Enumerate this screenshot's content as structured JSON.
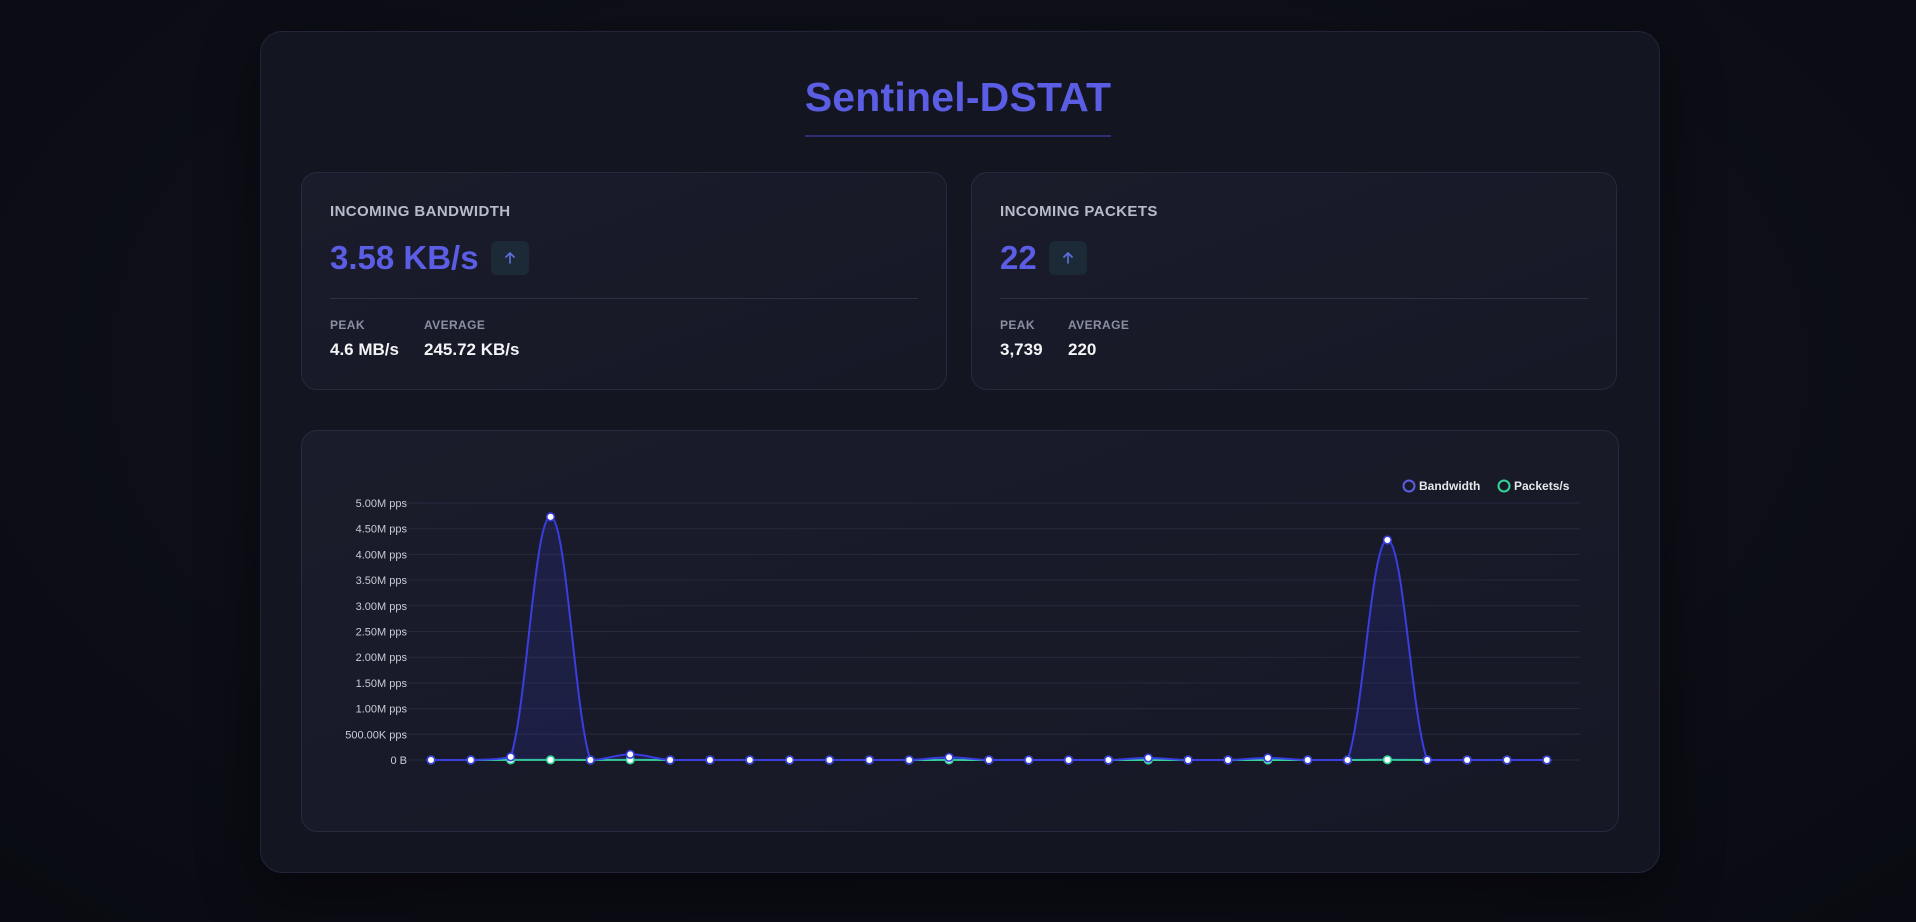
{
  "app": {
    "title": "Sentinel-DSTAT"
  },
  "colors": {
    "accent": "#5b5de4",
    "bandwidth_line": "#3a3de0",
    "packets_line": "#34d399"
  },
  "cards": [
    {
      "label": "INCOMING BANDWIDTH",
      "value": "3.58 KB/s",
      "trend_icon": "arrow-up-icon",
      "stats": [
        {
          "label": "PEAK",
          "value": "4.6 MB/s"
        },
        {
          "label": "AVERAGE",
          "value": "245.72 KB/s"
        }
      ]
    },
    {
      "label": "INCOMING PACKETS",
      "value": "22",
      "trend_icon": "arrow-up-icon",
      "stats": [
        {
          "label": "PEAK",
          "value": "3,739"
        },
        {
          "label": "AVERAGE",
          "value": "220"
        }
      ]
    }
  ],
  "chart_data": {
    "type": "line",
    "ylim": [
      0,
      5000000
    ],
    "yticks": [
      {
        "value": 0,
        "label": "0 B"
      },
      {
        "value": 500000,
        "label": "500.00K pps"
      },
      {
        "value": 1000000,
        "label": "1.00M pps"
      },
      {
        "value": 1500000,
        "label": "1.50M pps"
      },
      {
        "value": 2000000,
        "label": "2.00M pps"
      },
      {
        "value": 2500000,
        "label": "2.50M pps"
      },
      {
        "value": 3000000,
        "label": "3.00M pps"
      },
      {
        "value": 3500000,
        "label": "3.50M pps"
      },
      {
        "value": 4000000,
        "label": "4.00M pps"
      },
      {
        "value": 4500000,
        "label": "4.50M pps"
      },
      {
        "value": 5000000,
        "label": "5.00M pps"
      }
    ],
    "grid": true,
    "legend_position": "top-right",
    "series": [
      {
        "name": "Bandwidth",
        "color": "#3a3de0",
        "values": [
          0,
          0,
          60000,
          4730000,
          0,
          110000,
          0,
          0,
          0,
          0,
          0,
          0,
          0,
          50000,
          0,
          0,
          0,
          0,
          40000,
          0,
          0,
          40000,
          0,
          0,
          4280000,
          0,
          0,
          0,
          0
        ]
      },
      {
        "name": "Packets/s",
        "color": "#34d399",
        "values": [
          0,
          0,
          2000,
          3000,
          0,
          2500,
          0,
          0,
          0,
          0,
          0,
          0,
          0,
          1500,
          0,
          0,
          0,
          0,
          1000,
          0,
          0,
          1000,
          0,
          0,
          3739,
          0,
          0,
          0,
          0
        ]
      }
    ]
  }
}
